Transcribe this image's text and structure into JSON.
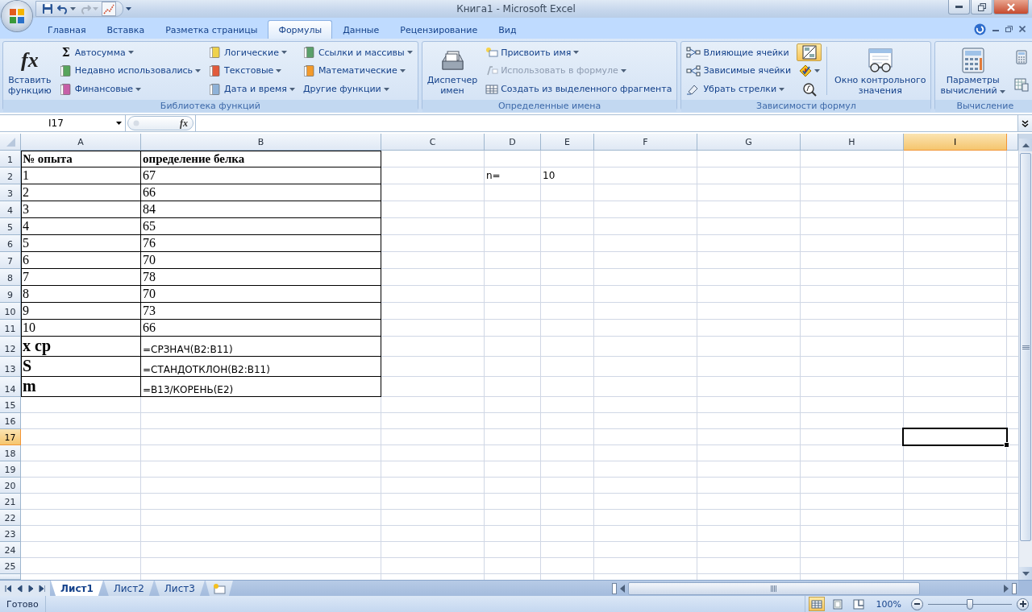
{
  "window": {
    "title": "Книга1 - Microsoft Excel"
  },
  "quick_access": [
    {
      "disabled": false
    },
    {
      "disabled": false
    },
    {
      "disabled": true
    },
    {
      "disabled": false
    }
  ],
  "tabs": [
    {
      "label": "Главная",
      "selected": false
    },
    {
      "label": "Вставка",
      "selected": false
    },
    {
      "label": "Разметка страницы",
      "selected": false
    },
    {
      "label": "Формулы",
      "selected": true
    },
    {
      "label": "Данные",
      "selected": false
    },
    {
      "label": "Рецензирование",
      "selected": false
    },
    {
      "label": "Вид",
      "selected": false
    }
  ],
  "ribbon": [
    {
      "title": "Библиотека функций",
      "controls": [
        {
          "kind": "large",
          "lines": [
            "Вставить",
            "функцию"
          ],
          "icon_text": "fx",
          "dropdown": false,
          "disabled": false,
          "pressed": false
        },
        {
          "kind": "small",
          "label": "Автосумма",
          "icon_text": "Σ",
          "dropdown": true,
          "disabled": false,
          "pressed": false
        },
        {
          "kind": "small",
          "label": "Недавно использовались",
          "dropdown": true,
          "disabled": false,
          "pressed": false
        },
        {
          "kind": "small",
          "label": "Финансовые",
          "dropdown": true,
          "disabled": false,
          "pressed": false
        },
        {
          "kind": "small",
          "label": "Логические",
          "dropdown": true,
          "disabled": false,
          "pressed": false
        },
        {
          "kind": "small",
          "label": "Текстовые",
          "dropdown": true,
          "disabled": false,
          "pressed": false
        },
        {
          "kind": "small",
          "label": "Дата и время",
          "dropdown": true,
          "disabled": false,
          "pressed": false
        },
        {
          "kind": "small",
          "label": "Ссылки и массивы",
          "dropdown": true,
          "disabled": false,
          "pressed": false
        },
        {
          "kind": "small",
          "label": "Математические",
          "dropdown": true,
          "disabled": false,
          "pressed": false
        },
        {
          "kind": "small",
          "label": "Другие функции",
          "dropdown": true,
          "disabled": false,
          "pressed": false
        }
      ]
    },
    {
      "title": "Определенные имена",
      "controls": [
        {
          "kind": "large",
          "lines": [
            "Диспетчер",
            "имен"
          ],
          "dropdown": false,
          "disabled": false,
          "pressed": false
        },
        {
          "kind": "small",
          "label": "Присвоить имя",
          "dropdown": true,
          "disabled": false,
          "pressed": false
        },
        {
          "kind": "small",
          "label": "Использовать в формуле",
          "dropdown": true,
          "disabled": true,
          "pressed": false
        },
        {
          "kind": "small",
          "label": "Создать из выделенного фрагмента",
          "dropdown": false,
          "disabled": false,
          "pressed": false
        }
      ]
    },
    {
      "title": "Зависимости формул",
      "controls": [
        {
          "kind": "small",
          "label": "Влияющие ячейки",
          "dropdown": false,
          "disabled": false,
          "pressed": false
        },
        {
          "kind": "small",
          "label": "Зависимые ячейки",
          "dropdown": false,
          "disabled": false,
          "pressed": false
        },
        {
          "kind": "small",
          "label": "Убрать стрелки",
          "dropdown": true,
          "disabled": false,
          "pressed": false
        },
        {
          "kind": "icon",
          "dropdown": false,
          "disabled": false,
          "pressed": true
        },
        {
          "kind": "icon",
          "dropdown": true,
          "disabled": false,
          "pressed": false
        },
        {
          "kind": "icon",
          "dropdown": false,
          "disabled": false,
          "pressed": false
        },
        {
          "kind": "large",
          "lines": [
            "Окно контрольного",
            "значения"
          ],
          "dropdown": false,
          "disabled": false,
          "pressed": false
        }
      ]
    },
    {
      "title": "Вычисление",
      "controls": [
        {
          "kind": "large",
          "lines": [
            "Параметры",
            "вычислений"
          ],
          "dropdown": true,
          "disabled": false,
          "pressed": false
        },
        {
          "kind": "icon",
          "dropdown": false,
          "disabled": false,
          "pressed": false
        },
        {
          "kind": "icon",
          "dropdown": false,
          "disabled": false,
          "pressed": false
        }
      ]
    }
  ],
  "formula_bar": {
    "name_box": "I17",
    "function_icon": "fx"
  },
  "sheet": {
    "columns": [
      {
        "label": "A",
        "selected": false
      },
      {
        "label": "B",
        "selected": false
      },
      {
        "label": "C",
        "selected": false
      },
      {
        "label": "D",
        "selected": false
      },
      {
        "label": "E",
        "selected": false
      },
      {
        "label": "F",
        "selected": false
      },
      {
        "label": "G",
        "selected": false
      },
      {
        "label": "H",
        "selected": false
      },
      {
        "label": "I",
        "selected": true
      }
    ],
    "rows": [
      {
        "header": "1",
        "selected": false,
        "cells": {
          "A": {
            "text": "№ опыта",
            "kind": "heading"
          },
          "B": {
            "text": "определение белка",
            "kind": "heading"
          }
        }
      },
      {
        "header": "2",
        "selected": false,
        "cells": {
          "A": {
            "text": "1",
            "kind": "value"
          },
          "B": {
            "text": "67",
            "kind": "value"
          },
          "D": {
            "text": "n=",
            "kind": "plain"
          },
          "E": {
            "text": "10",
            "kind": "plain"
          }
        }
      },
      {
        "header": "3",
        "selected": false,
        "cells": {
          "A": {
            "text": "2",
            "kind": "value"
          },
          "B": {
            "text": "66",
            "kind": "value"
          }
        }
      },
      {
        "header": "4",
        "selected": false,
        "cells": {
          "A": {
            "text": "3",
            "kind": "value"
          },
          "B": {
            "text": "84",
            "kind": "value"
          }
        }
      },
      {
        "header": "5",
        "selected": false,
        "cells": {
          "A": {
            "text": "4",
            "kind": "value"
          },
          "B": {
            "text": "65",
            "kind": "value"
          }
        }
      },
      {
        "header": "6",
        "selected": false,
        "cells": {
          "A": {
            "text": "5",
            "kind": "value"
          },
          "B": {
            "text": "76",
            "kind": "value"
          }
        }
      },
      {
        "header": "7",
        "selected": false,
        "cells": {
          "A": {
            "text": "6",
            "kind": "value"
          },
          "B": {
            "text": "70",
            "kind": "value"
          }
        }
      },
      {
        "header": "8",
        "selected": false,
        "cells": {
          "A": {
            "text": "7",
            "kind": "value"
          },
          "B": {
            "text": "78",
            "kind": "value"
          }
        }
      },
      {
        "header": "9",
        "selected": false,
        "cells": {
          "A": {
            "text": "8",
            "kind": "value"
          },
          "B": {
            "text": "70",
            "kind": "value"
          }
        }
      },
      {
        "header": "10",
        "selected": false,
        "cells": {
          "A": {
            "text": "9",
            "kind": "value"
          },
          "B": {
            "text": "73",
            "kind": "value"
          }
        }
      },
      {
        "header": "11",
        "selected": false,
        "cells": {
          "A": {
            "text": "10",
            "kind": "value"
          },
          "B": {
            "text": "66",
            "kind": "value"
          }
        }
      },
      {
        "header": "12",
        "selected": false,
        "cells": {
          "A": {
            "text": "x cp",
            "kind": "label"
          },
          "B": {
            "text": "=СРЗНАЧ(B2:B11)",
            "kind": "formula"
          }
        }
      },
      {
        "header": "13",
        "selected": false,
        "cells": {
          "A": {
            "text": "S",
            "kind": "label"
          },
          "B": {
            "text": "=СТАНДОТКЛОН(B2:B11)",
            "kind": "formula"
          }
        }
      },
      {
        "header": "14",
        "selected": false,
        "cells": {
          "A": {
            "text": "m",
            "kind": "label"
          },
          "B": {
            "text": "=B13/КОРЕНЬ(E2)",
            "kind": "formula"
          }
        }
      },
      {
        "header": "15",
        "selected": false,
        "cells": {}
      },
      {
        "header": "16",
        "selected": false,
        "cells": {}
      },
      {
        "header": "17",
        "selected": true,
        "cells": {}
      },
      {
        "header": "18",
        "selected": false,
        "cells": {}
      },
      {
        "header": "19",
        "selected": false,
        "cells": {}
      },
      {
        "header": "20",
        "selected": false,
        "cells": {}
      },
      {
        "header": "21",
        "selected": false,
        "cells": {}
      },
      {
        "header": "22",
        "selected": false,
        "cells": {}
      },
      {
        "header": "23",
        "selected": false,
        "cells": {}
      },
      {
        "header": "24",
        "selected": false,
        "cells": {}
      },
      {
        "header": "25",
        "selected": false,
        "cells": {}
      }
    ]
  },
  "sheet_tabs": [
    {
      "label": "Лист1",
      "selected": true
    },
    {
      "label": "Лист2",
      "selected": false
    },
    {
      "label": "Лист3",
      "selected": false
    }
  ],
  "status_bar": {
    "status": "Готово",
    "views": [
      {
        "selected": true
      },
      {
        "selected": false
      },
      {
        "selected": false
      }
    ],
    "zoom": "100%",
    "zoom_slider": {
      "level": 0.5
    }
  }
}
